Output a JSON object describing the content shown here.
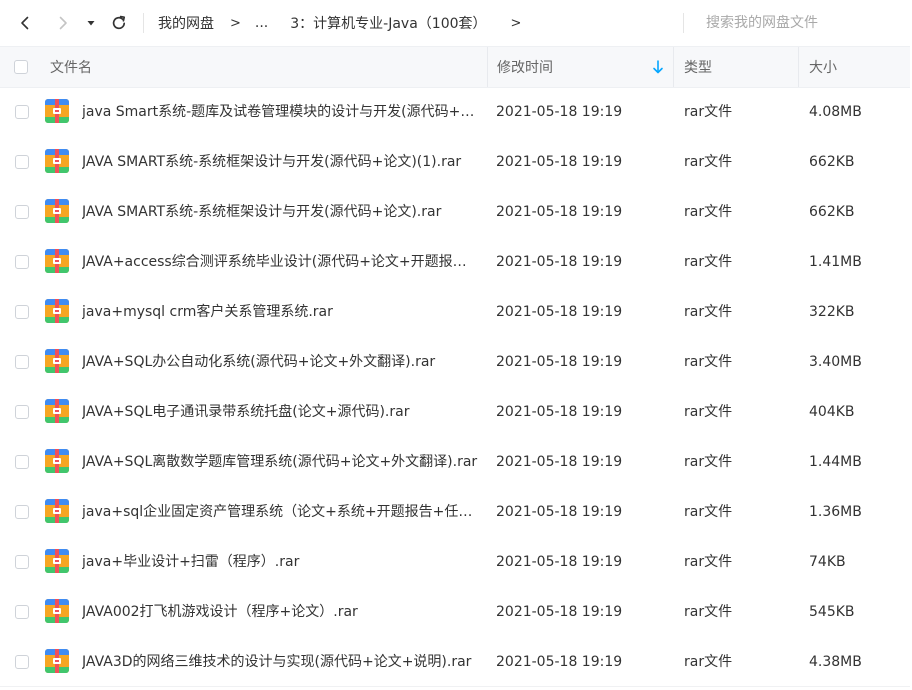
{
  "nav": {
    "back_icon": "chevron-left-icon",
    "forward_icon": "chevron-right-icon",
    "history_icon": "caret-down-icon",
    "refresh_icon": "refresh-icon"
  },
  "breadcrumb": {
    "root": "我的网盘",
    "separator": ">",
    "ellipsis": "...",
    "current": "3：计算机专业-Java（100套）",
    "tail": ">"
  },
  "search": {
    "placeholder": "搜索我的网盘文件"
  },
  "table": {
    "headers": {
      "name": "文件名",
      "time": "修改时间",
      "type": "类型",
      "size": "大小"
    },
    "sort_icon": "sort-down-arrow-icon",
    "file_icon": "rar-archive-icon",
    "rows": [
      {
        "name": "java Smart系统-题库及试卷管理模块的设计与开发(源代码+论文).rar",
        "time": "2021-05-18 19:19",
        "type": "rar文件",
        "size": "4.08MB"
      },
      {
        "name": "JAVA SMART系统-系统框架设计与开发(源代码+论文)(1).rar",
        "time": "2021-05-18 19:19",
        "type": "rar文件",
        "size": "662KB"
      },
      {
        "name": "JAVA SMART系统-系统框架设计与开发(源代码+论文).rar",
        "time": "2021-05-18 19:19",
        "type": "rar文件",
        "size": "662KB"
      },
      {
        "name": "JAVA+access综合测评系统毕业设计(源代码+论文+开题报告).rar",
        "time": "2021-05-18 19:19",
        "type": "rar文件",
        "size": "1.41MB"
      },
      {
        "name": "java+mysql crm客户关系管理系统.rar",
        "time": "2021-05-18 19:19",
        "type": "rar文件",
        "size": "322KB"
      },
      {
        "name": "JAVA+SQL办公自动化系统(源代码+论文+外文翻译).rar",
        "time": "2021-05-18 19:19",
        "type": "rar文件",
        "size": "3.40MB"
      },
      {
        "name": "JAVA+SQL电子通讯录带系统托盘(论文+源代码).rar",
        "time": "2021-05-18 19:19",
        "type": "rar文件",
        "size": "404KB"
      },
      {
        "name": "JAVA+SQL离散数学题库管理系统(源代码+论文+外文翻译).rar",
        "time": "2021-05-18 19:19",
        "type": "rar文件",
        "size": "1.44MB"
      },
      {
        "name": "java+sql企业固定资产管理系统（论文+系统+开题报告+任务书）.rar",
        "time": "2021-05-18 19:19",
        "type": "rar文件",
        "size": "1.36MB"
      },
      {
        "name": "java+毕业设计+扫雷（程序）.rar",
        "time": "2021-05-18 19:19",
        "type": "rar文件",
        "size": "74KB"
      },
      {
        "name": "JAVA002打飞机游戏设计（程序+论文）.rar",
        "time": "2021-05-18 19:19",
        "type": "rar文件",
        "size": "545KB"
      },
      {
        "name": "JAVA3D的网络三维技术的设计与实现(源代码+论文+说明).rar",
        "time": "2021-05-18 19:19",
        "type": "rar文件",
        "size": "4.38MB"
      }
    ]
  },
  "colors": {
    "accent": "#06a7ff",
    "header_bg": "#f7f8fa",
    "icon_blue": "#3f8cf3",
    "icon_orange": "#f6a623",
    "icon_green": "#41c66d",
    "icon_red": "#f0505a"
  }
}
